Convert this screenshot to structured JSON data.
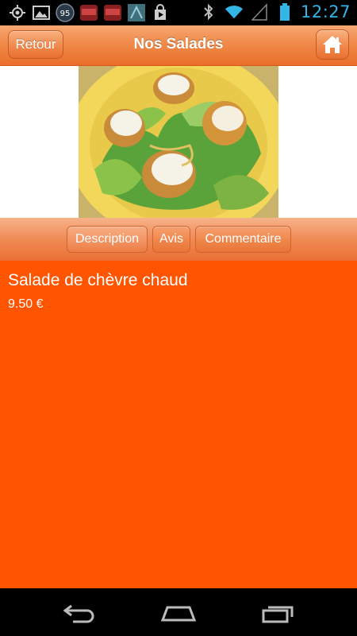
{
  "statusbar": {
    "clock": "12:27",
    "badge_number": "95",
    "icons": [
      "gps-icon",
      "gallery-icon",
      "notification-95-icon",
      "app-icon-1",
      "app-icon-2",
      "app-icon-3",
      "shopping-bag-icon",
      "bluetooth-icon",
      "wifi-icon",
      "signal-icon",
      "battery-icon"
    ]
  },
  "header": {
    "back_label": "Retour",
    "title": "Nos Salades",
    "home_icon": "home-icon"
  },
  "image": {
    "alt": "salad-photo"
  },
  "tabs": [
    {
      "label": "Description",
      "active": true
    },
    {
      "label": "Avis",
      "active": false
    },
    {
      "label": "Commentaire",
      "active": false
    }
  ],
  "dish": {
    "name": "Salade de chèvre chaud",
    "price": "9.50 €"
  },
  "colors": {
    "accent": "#ff5500",
    "clock": "#33b5e5"
  }
}
